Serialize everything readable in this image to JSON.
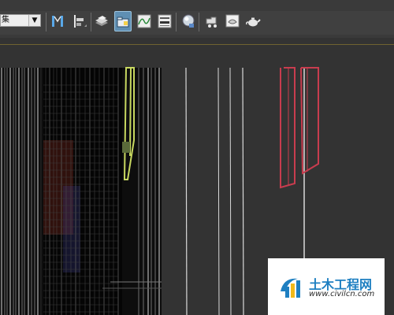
{
  "toolbar": {
    "selection_set_value": "集",
    "dropdown_arrow": "▼",
    "buttons": [
      {
        "name": "mirror-button",
        "icon": "mirror-icon",
        "active": false
      },
      {
        "name": "align-button",
        "icon": "align-icon",
        "active": false
      },
      {
        "name": "layer-manager-button",
        "icon": "layers-icon",
        "active": false
      },
      {
        "name": "scene-explorer-button",
        "icon": "scene-explorer-icon",
        "active": true
      },
      {
        "name": "curve-editor-button",
        "icon": "curve-editor-icon",
        "active": false
      },
      {
        "name": "schematic-view-button",
        "icon": "schematic-view-icon",
        "active": false
      },
      {
        "name": "material-editor-button",
        "icon": "material-editor-icon",
        "active": false
      },
      {
        "name": "render-setup-button",
        "icon": "render-setup-icon",
        "active": false
      },
      {
        "name": "rendered-frame-window-button",
        "icon": "rendered-frame-icon",
        "active": false
      },
      {
        "name": "render-production-button",
        "icon": "teapot-icon",
        "active": false
      }
    ]
  },
  "viewport": {
    "background_color": "#333333",
    "wire_color_white": "#d9d9d9",
    "wire_color_yellow": "#c8d860",
    "wire_color_red": "#c83c4e"
  },
  "watermark": {
    "title": "土木工程网",
    "url": "www.civilcn.com",
    "accent_color": "#1e7fc1"
  }
}
